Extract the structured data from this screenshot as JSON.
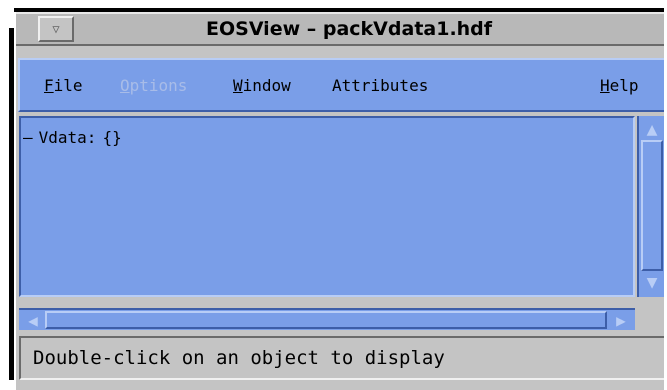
{
  "window": {
    "title": "EOSView – packVdata1.hdf",
    "menu_button_glyph": "▽"
  },
  "menubar": {
    "items": [
      {
        "label_mnemonic": "F",
        "label_rest": "ile",
        "enabled": true
      },
      {
        "label_mnemonic": "O",
        "label_rest": "ptions",
        "enabled": false
      },
      {
        "label_mnemonic": "W",
        "label_rest": "indow",
        "enabled": true
      },
      {
        "label_mnemonic": "",
        "label_rest": "Attributes",
        "enabled": true
      },
      {
        "label_mnemonic": "H",
        "label_rest": "elp",
        "enabled": true
      }
    ]
  },
  "tree": {
    "rows": [
      {
        "expander": "–",
        "label": "Vdata:",
        "value": "{}"
      }
    ]
  },
  "status": {
    "text": "Double-click on an object to display"
  },
  "colors": {
    "panel_blue": "#7a9ee8",
    "chrome_gray": "#c4c4c4"
  },
  "icons": {
    "window_menu": "window-menu-icon",
    "scroll_up": "scroll-up-arrow-icon",
    "scroll_down": "scroll-down-arrow-icon",
    "scroll_left": "scroll-left-arrow-icon",
    "scroll_right": "scroll-right-arrow-icon"
  }
}
